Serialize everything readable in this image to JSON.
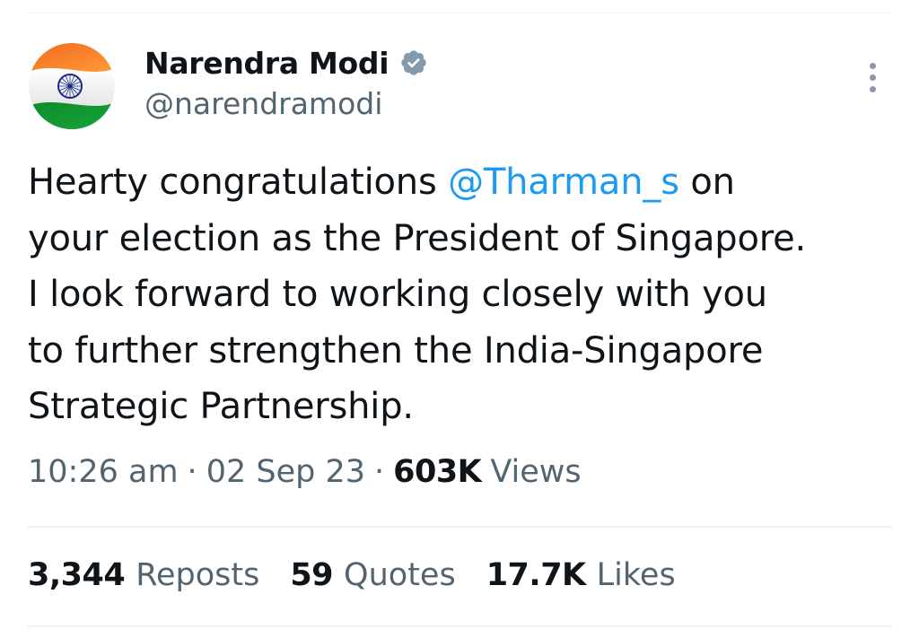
{
  "author": {
    "display_name": "Narendra Modi",
    "handle": "@narendramodi",
    "verified_icon": "verified-badge-icon",
    "avatar": "india-flag-avatar"
  },
  "tweet": {
    "text_before_mention": "Hearty congratulations ",
    "mention": "@Tharman_s",
    "text_after_mention": " on\nyour election as the President of Singapore.\nI look forward to working closely with you\nto further strengthen the India-Singapore\nStrategic Partnership."
  },
  "meta": {
    "time": "10:26 am",
    "separator": "·",
    "date": "02 Sep 23",
    "views_count": "603K",
    "views_label": "Views"
  },
  "stats": {
    "reposts_count": "3,344",
    "reposts_label": "Reposts",
    "quotes_count": "59",
    "quotes_label": "Quotes",
    "likes_count": "17.7K",
    "likes_label": "Likes"
  },
  "colors": {
    "accent": "#1d9bf0",
    "text": "#0f1419",
    "secondary": "#536471",
    "saffron": "#ff9933",
    "green": "#138808",
    "chakra": "#000080"
  }
}
